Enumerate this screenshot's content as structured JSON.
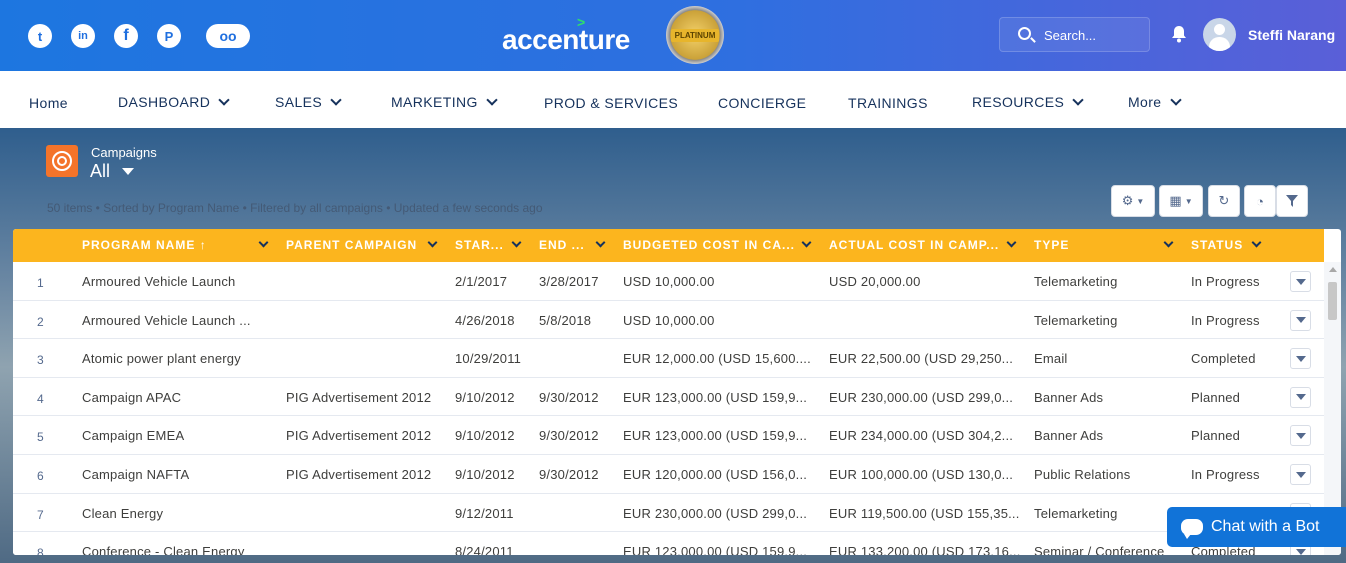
{
  "header": {
    "social": [
      {
        "name": "twitter-icon",
        "glyph": "t"
      },
      {
        "name": "linkedin-icon",
        "glyph": "in"
      },
      {
        "name": "facebook-icon",
        "glyph": "f"
      },
      {
        "name": "pinterest-icon",
        "glyph": "P"
      },
      {
        "name": "flickr-icon",
        "glyph": "oo"
      }
    ],
    "logo": "accenture",
    "badge": "PLATINUM",
    "search_placeholder": "Search...",
    "user_name": "Steffi Narang"
  },
  "nav": {
    "items": [
      {
        "label": "Home",
        "dropdown": false
      },
      {
        "label": "DASHBOARD",
        "dropdown": true
      },
      {
        "label": "SALES",
        "dropdown": true
      },
      {
        "label": "MARKETING",
        "dropdown": true
      },
      {
        "label": "PROD & SERVICES",
        "dropdown": false
      },
      {
        "label": "CONCIERGE",
        "dropdown": false
      },
      {
        "label": "TRAININGS",
        "dropdown": false
      },
      {
        "label": "RESOURCES",
        "dropdown": true
      },
      {
        "label": "More",
        "dropdown": true
      }
    ]
  },
  "list": {
    "object_label": "Campaigns",
    "view_name": "All",
    "info": "50 items • Sorted by Program Name • Filtered by all campaigns • Updated a few seconds ago",
    "columns": [
      "PROGRAM NAME",
      "PARENT CAMPAIGN",
      "STAR...",
      "END ...",
      "BUDGETED COST IN CA...",
      "ACTUAL COST IN CAMP...",
      "TYPE",
      "STATUS"
    ],
    "sort_indicator": "↑",
    "rows": [
      {
        "num": "1",
        "name": "Armoured Vehicle Launch",
        "parent": "",
        "start": "2/1/2017",
        "end": "3/28/2017",
        "budget": "USD 10,000.00",
        "actual": "USD 20,000.00",
        "type": "Telemarketing",
        "status": "In Progress"
      },
      {
        "num": "2",
        "name": "Armoured Vehicle Launch ...",
        "parent": "",
        "start": "4/26/2018",
        "end": "5/8/2018",
        "budget": "USD 10,000.00",
        "actual": "",
        "type": "Telemarketing",
        "status": "In Progress"
      },
      {
        "num": "3",
        "name": "Atomic power plant energy",
        "parent": "",
        "start": "10/29/2011",
        "end": "",
        "budget": "EUR 12,000.00 (USD 15,600....",
        "actual": "EUR 22,500.00 (USD 29,250...",
        "type": "Email",
        "status": "Completed"
      },
      {
        "num": "4",
        "name": "Campaign APAC",
        "parent": "PIG Advertisement 2012",
        "start": "9/10/2012",
        "end": "9/30/2012",
        "budget": "EUR 123,000.00 (USD 159,9...",
        "actual": "EUR 230,000.00 (USD 299,0...",
        "type": "Banner Ads",
        "status": "Planned"
      },
      {
        "num": "5",
        "name": "Campaign EMEA",
        "parent": "PIG Advertisement 2012",
        "start": "9/10/2012",
        "end": "9/30/2012",
        "budget": "EUR 123,000.00 (USD 159,9...",
        "actual": "EUR 234,000.00 (USD 304,2...",
        "type": "Banner Ads",
        "status": "Planned"
      },
      {
        "num": "6",
        "name": "Campaign NAFTA",
        "parent": "PIG Advertisement 2012",
        "start": "9/10/2012",
        "end": "9/30/2012",
        "budget": "EUR 120,000.00 (USD 156,0...",
        "actual": "EUR 100,000.00 (USD 130,0...",
        "type": "Public Relations",
        "status": "In Progress"
      },
      {
        "num": "7",
        "name": "Clean Energy",
        "parent": "",
        "start": "9/12/2011",
        "end": "",
        "budget": "EUR 230,000.00 (USD 299,0...",
        "actual": "EUR 119,500.00 (USD 155,35...",
        "type": "Telemarketing",
        "status": ""
      },
      {
        "num": "8",
        "name": "Conference - Clean Energy",
        "parent": "",
        "start": "8/24/2011",
        "end": "",
        "budget": "EUR 123,000.00 (USD 159,9...",
        "actual": "EUR 133,200.00 (USD 173,16...",
        "type": "Seminar / Conference",
        "status": "Completed"
      }
    ]
  },
  "chat": {
    "label": "Chat with a Bot"
  },
  "colors": {
    "header_start": "#1d76e0",
    "header_end": "#5a5fd8",
    "table_header": "#fcb51e",
    "object_icon": "#f4742a",
    "chat": "#1173d8"
  }
}
